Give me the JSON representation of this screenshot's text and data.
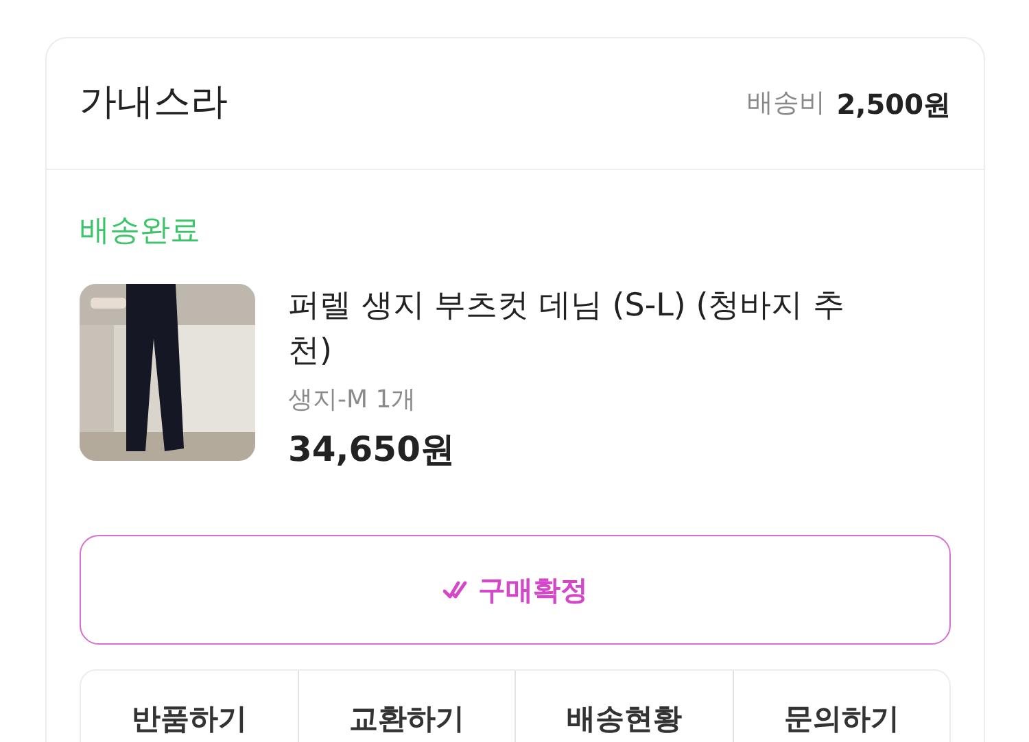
{
  "shop": {
    "name": "가내스라",
    "shipping_label": "배송비",
    "shipping_fee": "2,500원"
  },
  "status": "배송완료",
  "product": {
    "title": "퍼렐 생지 부츠컷 데님 (S-L) (청바지 추천)",
    "option": "생지-M 1개",
    "price": "34,650원"
  },
  "confirm_button": {
    "label": "구매확정"
  },
  "actions": [
    {
      "label": "반품하기"
    },
    {
      "label": "교환하기"
    },
    {
      "label": "배송현황"
    },
    {
      "label": "문의하기"
    }
  ]
}
